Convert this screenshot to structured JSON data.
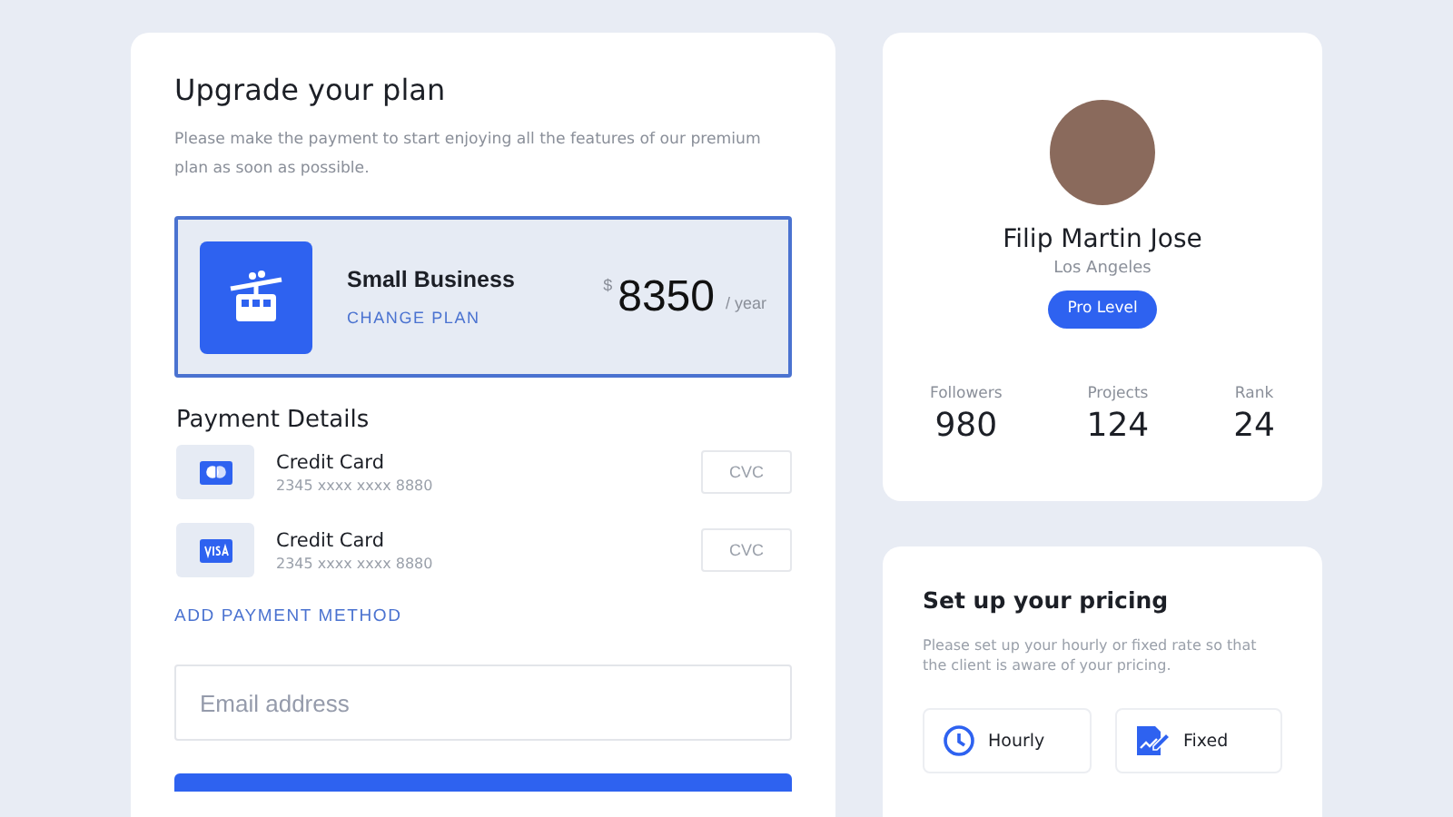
{
  "upgrade": {
    "title": "Upgrade your plan",
    "description": "Please make the payment to start enjoying all the features of our premium plan as soon as possible.",
    "plan": {
      "name": "Small Business",
      "change_link": "CHANGE PLAN",
      "currency": "$",
      "price": "8350",
      "period": "/ year"
    },
    "payment_title": "Payment Details",
    "cards": [
      {
        "kind": "mastercard",
        "name": "Credit Card",
        "number": "2345 xxxx xxxx 8880",
        "cvc_placeholder": "CVC"
      },
      {
        "kind": "visa",
        "name": "Credit Card",
        "number": "2345 xxxx xxxx 8880",
        "cvc_placeholder": "CVC"
      }
    ],
    "add_link": "ADD PAYMENT METHOD",
    "email": {
      "placeholder": "Email address"
    }
  },
  "profile": {
    "name": "Filip Martin Jose",
    "city": "Los Angeles",
    "badge": "Pro Level",
    "stats": [
      {
        "label": "Followers",
        "value": "980"
      },
      {
        "label": "Projects",
        "value": "124"
      },
      {
        "label": "Rank",
        "value": "24"
      }
    ]
  },
  "pricing": {
    "title": "Set up your pricing",
    "description": "Please set up your hourly or fixed rate so that the client is aware of your pricing.",
    "options": [
      {
        "kind": "hourly",
        "label": "Hourly"
      },
      {
        "kind": "fixed",
        "label": "Fixed"
      }
    ]
  }
}
